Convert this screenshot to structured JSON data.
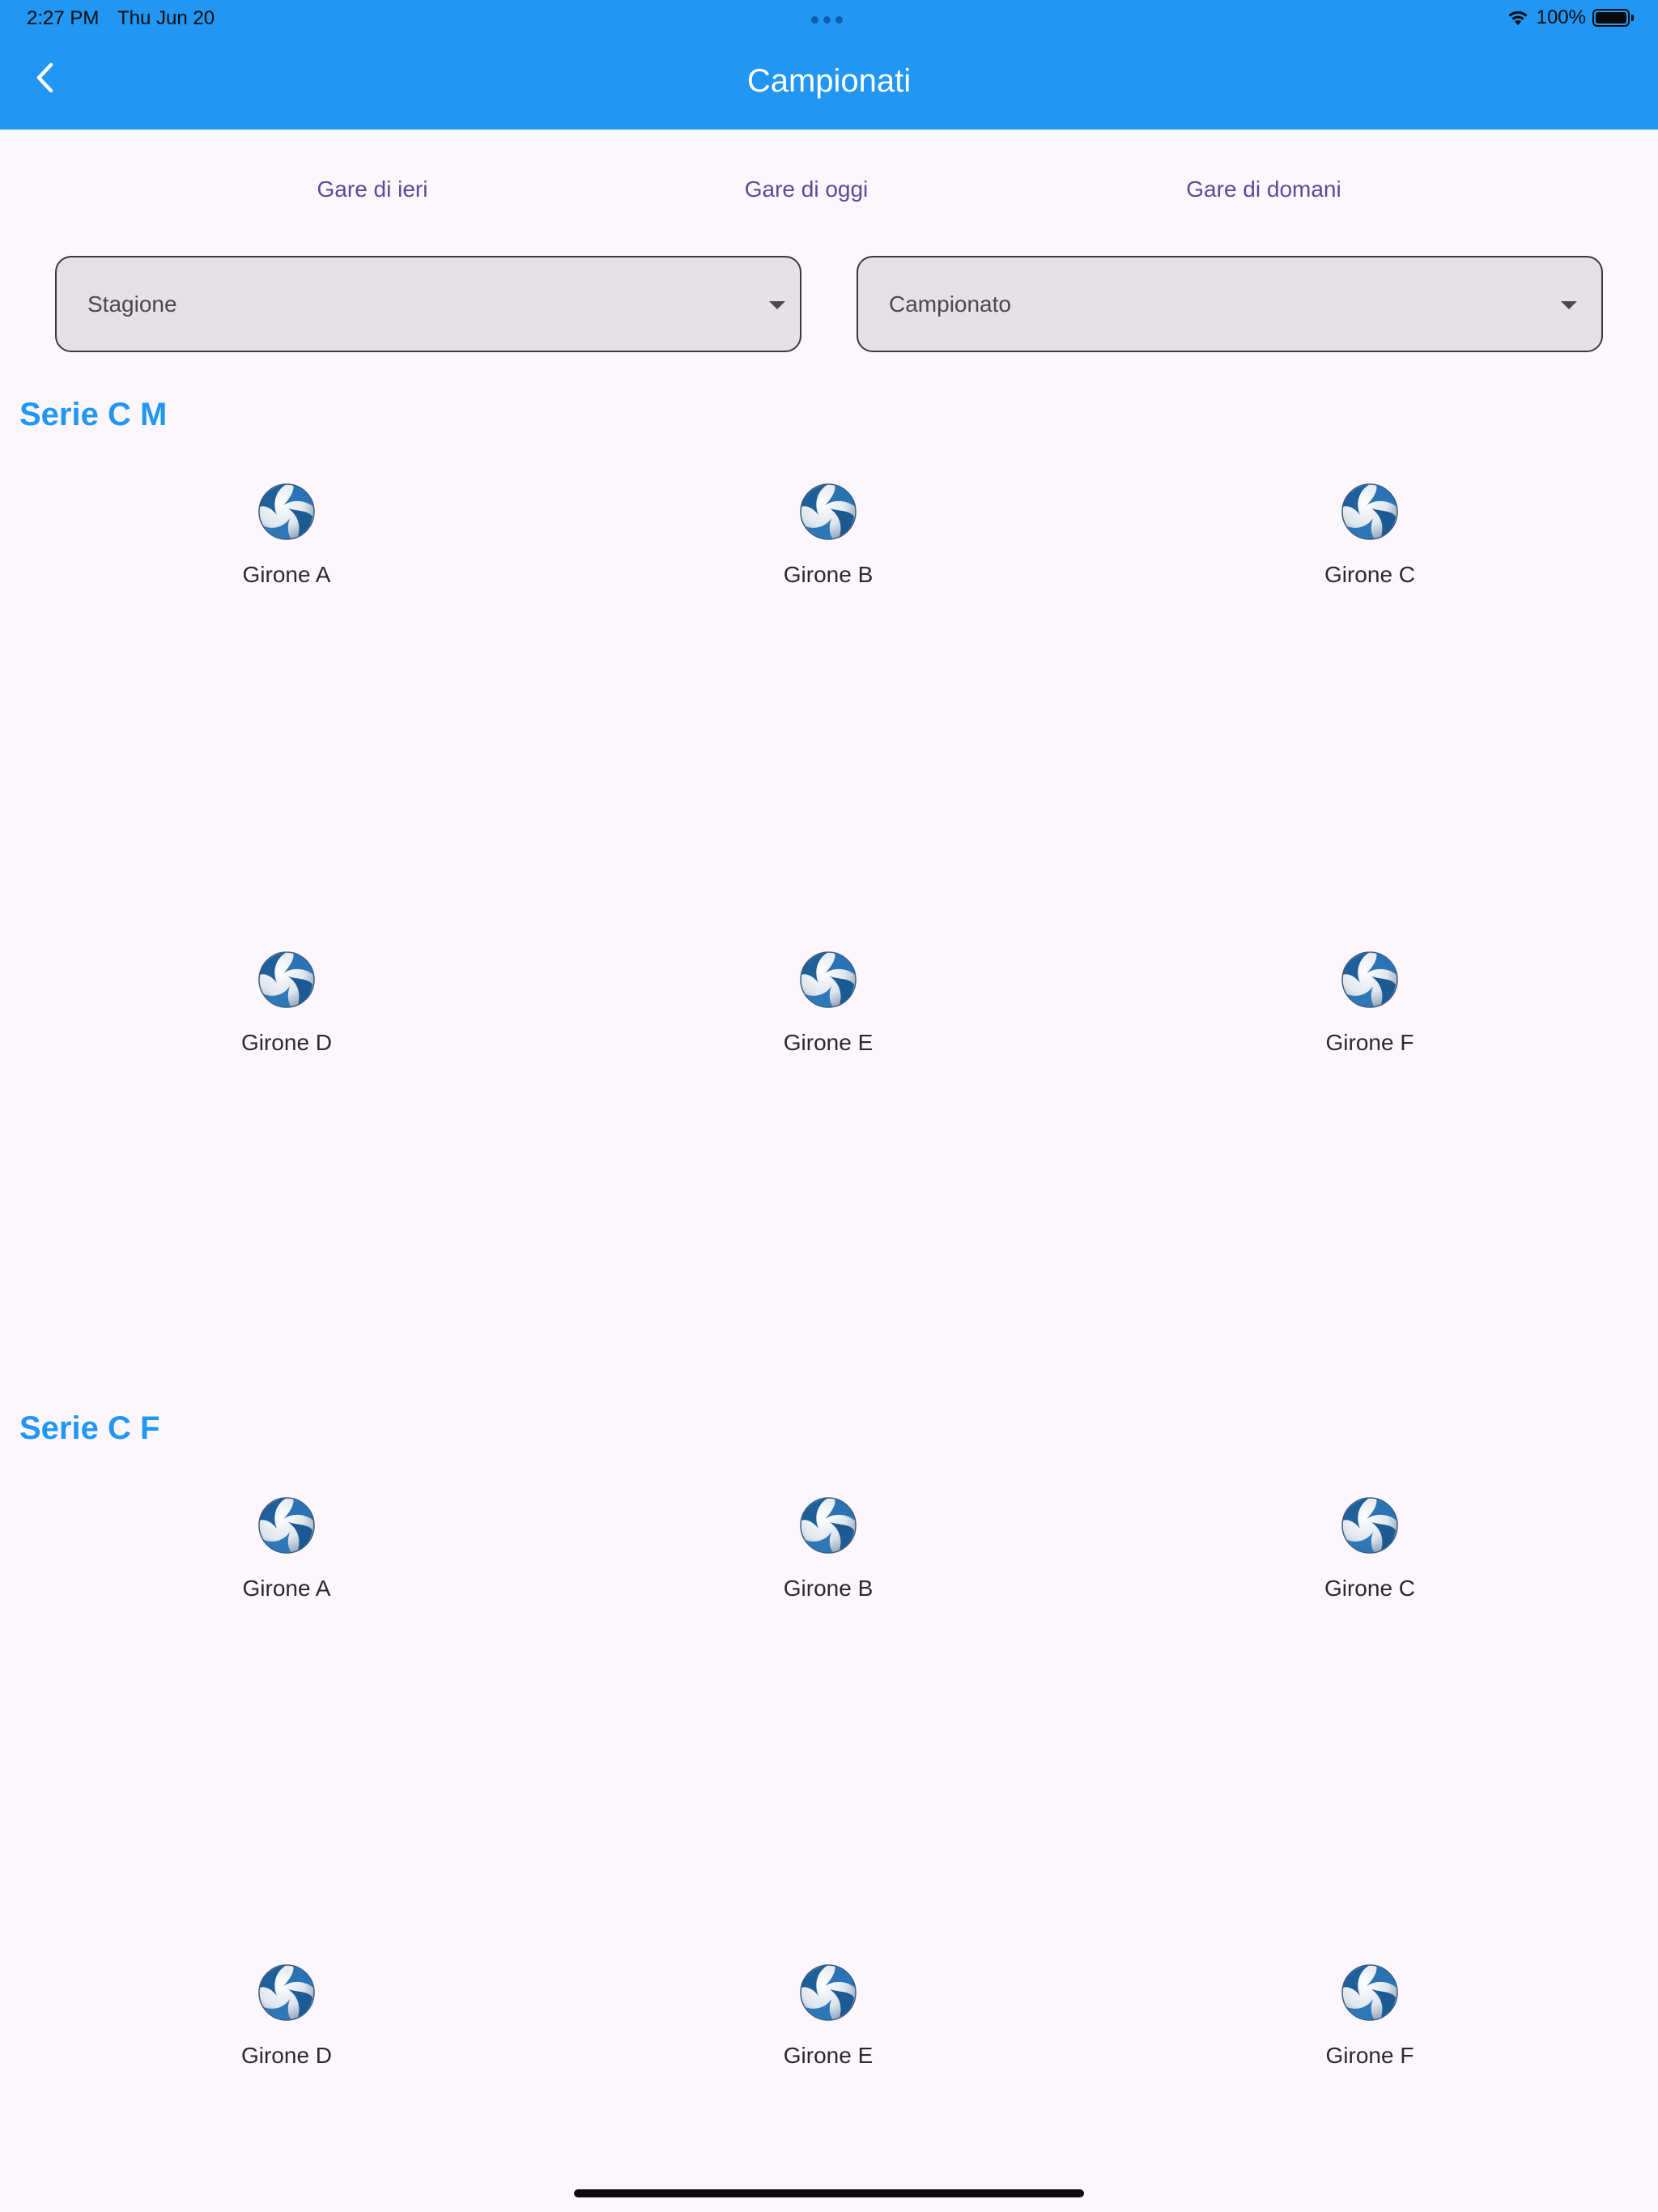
{
  "status_bar": {
    "time": "2:27 PM",
    "date": "Thu Jun 20",
    "battery": "100%"
  },
  "app_bar": {
    "title": "Campionati",
    "back_icon": "chevron-left-icon"
  },
  "day_tabs": [
    {
      "label": "Gare di ieri"
    },
    {
      "label": "Gare di oggi"
    },
    {
      "label": "Gare di domani"
    }
  ],
  "filters": {
    "season": {
      "label": "Stagione"
    },
    "championship": {
      "label": "Campionato"
    }
  },
  "sections": [
    {
      "title": "Serie C M",
      "groups": [
        {
          "label": "Girone A",
          "icon": "volleyball-icon"
        },
        {
          "label": "Girone B",
          "icon": "volleyball-icon"
        },
        {
          "label": "Girone C",
          "icon": "volleyball-icon"
        },
        {
          "label": "Girone D",
          "icon": "volleyball-icon"
        },
        {
          "label": "Girone E",
          "icon": "volleyball-icon"
        },
        {
          "label": "Girone F",
          "icon": "volleyball-icon"
        }
      ]
    },
    {
      "title": "Serie C F",
      "groups": [
        {
          "label": "Girone A",
          "icon": "volleyball-icon"
        },
        {
          "label": "Girone B",
          "icon": "volleyball-icon"
        },
        {
          "label": "Girone C",
          "icon": "volleyball-icon"
        },
        {
          "label": "Girone D",
          "icon": "volleyball-icon"
        },
        {
          "label": "Girone E",
          "icon": "volleyball-icon"
        },
        {
          "label": "Girone F",
          "icon": "volleyball-icon"
        }
      ]
    }
  ],
  "colors": {
    "primary": "#2196f3",
    "background": "#fdf7fd",
    "tab_text": "#5b4a96"
  }
}
